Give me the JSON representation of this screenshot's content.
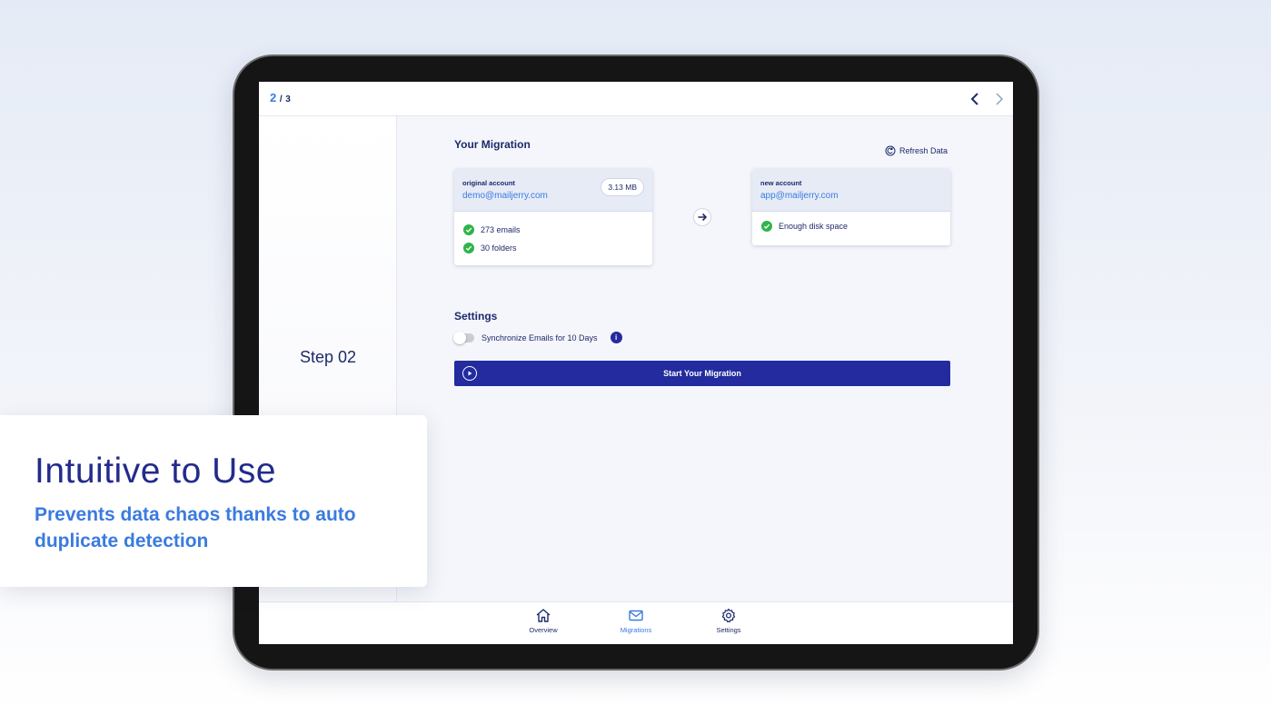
{
  "topbar": {
    "page_current": "2",
    "page_sep": "/",
    "page_total": "3"
  },
  "left_panel": {
    "step_label": "Step 02"
  },
  "migration": {
    "heading": "Your Migration",
    "refresh_label": "Refresh Data",
    "original": {
      "label": "original account",
      "email": "demo@mailjerry.com",
      "size": "3.13 MB",
      "checks": [
        "273 emails",
        "30 folders"
      ]
    },
    "new": {
      "label": "new account",
      "email": "app@mailjerry.com",
      "checks": [
        "Enough disk space"
      ]
    }
  },
  "settings": {
    "heading": "Settings",
    "sync_label": "Synchronize Emails for 10 Days",
    "sync_enabled": false
  },
  "start_button": {
    "label": "Start Your Migration"
  },
  "bottom_nav": {
    "tabs": [
      {
        "label": "Overview",
        "icon": "home-icon",
        "active": false
      },
      {
        "label": "Migrations",
        "icon": "mail-icon",
        "active": true
      },
      {
        "label": "Settings",
        "icon": "gear-icon",
        "active": false
      }
    ]
  },
  "promo": {
    "title": "Intuitive to Use",
    "subtitle": "Prevents data chaos thanks to auto duplicate detection"
  },
  "colors": {
    "primary": "#232b9e",
    "accent_blue": "#3a7be0",
    "success": "#2fb44a",
    "text_dark": "#1d2a6b"
  }
}
